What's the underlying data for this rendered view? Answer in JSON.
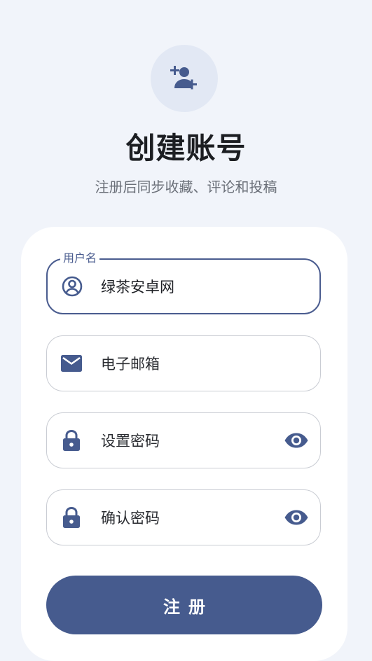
{
  "header": {
    "icon": "person-add-icon",
    "title": "创建账号",
    "subtitle": "注册后同步收藏、评论和投稿"
  },
  "form": {
    "username": {
      "label": "用户名",
      "value": "绿茶安卓网",
      "icon": "account-circle-icon"
    },
    "email": {
      "placeholder": "电子邮箱",
      "icon": "mail-icon"
    },
    "password": {
      "placeholder": "设置密码",
      "icon": "lock-icon",
      "toggle_icon": "eye-icon"
    },
    "confirm_password": {
      "placeholder": "确认密码",
      "icon": "lock-icon",
      "toggle_icon": "eye-icon"
    },
    "submit_label": "注册"
  },
  "colors": {
    "accent": "#465b8e",
    "background": "#f1f4fa",
    "card": "#ffffff",
    "border": "#c9ccd3"
  }
}
